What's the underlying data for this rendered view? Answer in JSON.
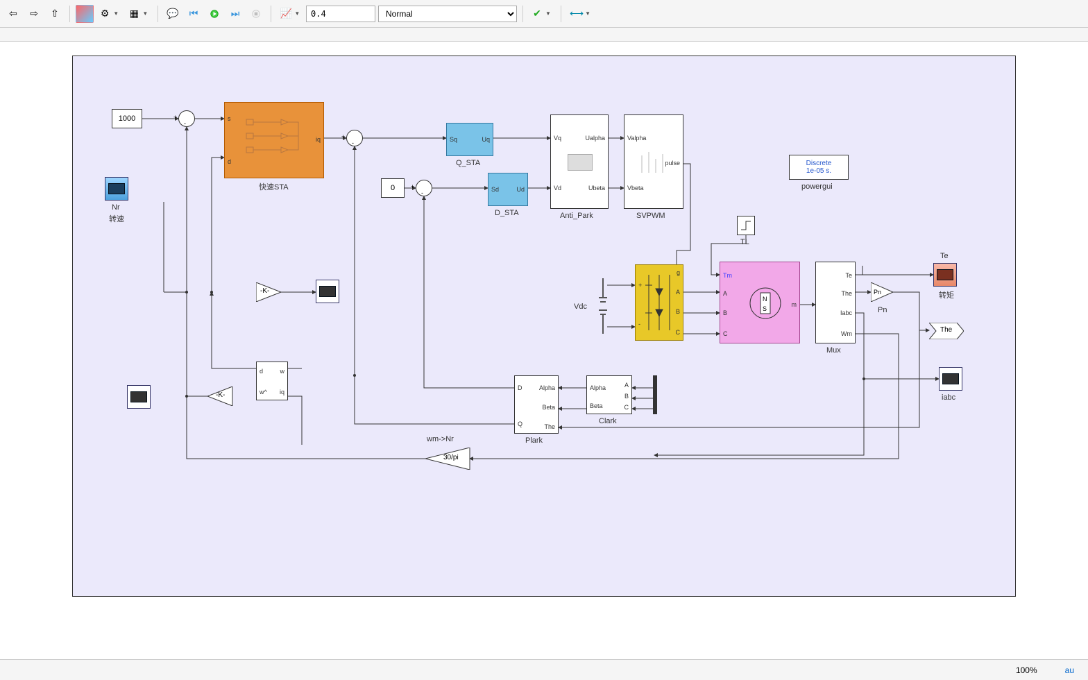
{
  "toolbar": {
    "stop_time": "0.4",
    "mode": "Normal"
  },
  "status": {
    "zoom": "100%",
    "solver": "au"
  },
  "blocks": {
    "const_1000": "1000",
    "const_0": "0",
    "nr_label": "Nr",
    "nr_sub": "转速",
    "fast_sta_label": "快速STA",
    "fast_sta_port_s": "s",
    "fast_sta_port_d": "d",
    "fast_sta_port_iq": "iq",
    "q_sta_label": "Q_STA",
    "q_sta_sq": "Sq",
    "q_sta_uq": "Uq",
    "d_sta_label": "D_STA",
    "d_sta_sd": "Sd",
    "d_sta_ud": "Ud",
    "anti_park_label": "Anti_Park",
    "anti_park_vq": "Vq",
    "anti_park_vd": "Vd",
    "anti_park_ualpha": "Ualpha",
    "anti_park_ubeta": "Ubeta",
    "svpwm_label": "SVPWM",
    "svpwm_valpha": "Valpha",
    "svpwm_vbeta": "Vbeta",
    "svpwm_pulse": "pulse",
    "powergui_label": "powergui",
    "powergui_l1": "Discrete",
    "powergui_l2": "1e-05 s.",
    "tl_label": "TL",
    "vdc_label": "Vdc",
    "inverter_g": "g",
    "inverter_A": "A",
    "inverter_B": "B",
    "inverter_C": "C",
    "motor_tm": "Tm",
    "motor_A": "A",
    "motor_B": "B",
    "motor_C": "C",
    "motor_m": "m",
    "mux_label": "Mux",
    "mux_te": "Te",
    "mux_the": "The",
    "mux_iabc": "Iabc",
    "mux_wm": "Wm",
    "te_label": "Te",
    "te_sub": "转矩",
    "pn_gain": "Pn",
    "pn_label": "Pn",
    "the_goto": "The",
    "iabc_label": "iabc",
    "clark_label": "Clark",
    "clark_alpha": "Alpha",
    "clark_beta": "Beta",
    "clark_A": "A",
    "clark_B": "B",
    "clark_C": "C",
    "plark_label": "Plark",
    "plark_alpha": "Alpha",
    "plark_beta": "Beta",
    "plark_the": "The",
    "plark_D": "D",
    "plark_Q": "Q",
    "gain_k1": "-K-",
    "gain_k2": "-K-",
    "gain_30pi": "30/pi",
    "wm_nr_label": "wm->Nr",
    "obs_d": "d",
    "obs_w": "w",
    "obs_wh": "w^",
    "obs_iq": "iq"
  }
}
